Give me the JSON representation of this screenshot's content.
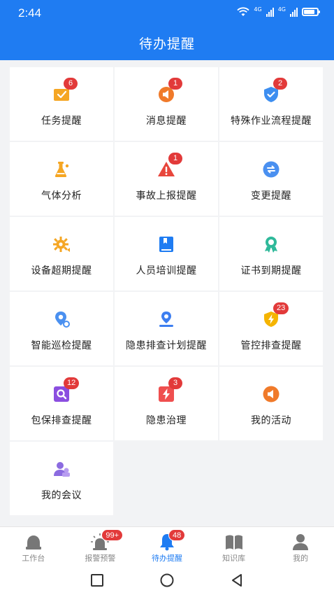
{
  "status_bar": {
    "time": "2:44",
    "network_1": "4G",
    "network_2": "4G"
  },
  "header": {
    "title": "待办提醒"
  },
  "grid": [
    {
      "label": "任务提醒",
      "badge": "6",
      "icon": "task-icon",
      "color": "#f5a623"
    },
    {
      "label": "消息提醒",
      "badge": "1",
      "icon": "message-icon",
      "color": "#f07a2a"
    },
    {
      "label": "特殊作业流程提醒",
      "badge": "2",
      "icon": "shield-check-icon",
      "color": "#3d8ef0"
    },
    {
      "label": "气体分析",
      "badge": "",
      "icon": "flask-icon",
      "color": "#f5a623"
    },
    {
      "label": "事故上报提醒",
      "badge": "1",
      "icon": "warning-icon",
      "color": "#e8463c"
    },
    {
      "label": "变更提醒",
      "badge": "",
      "icon": "exchange-icon",
      "color": "#4a90f0"
    },
    {
      "label": "设备超期提醒",
      "badge": "",
      "icon": "gear-icon",
      "color": "#f5a623"
    },
    {
      "label": "人员培训提醒",
      "badge": "",
      "icon": "book-icon",
      "color": "#1f7cf2"
    },
    {
      "label": "证书到期提醒",
      "badge": "",
      "icon": "certificate-icon",
      "color": "#2fb99a"
    },
    {
      "label": "智能巡检提醒",
      "badge": "",
      "icon": "patrol-icon",
      "color": "#4a90f0"
    },
    {
      "label": "隐患排查计划提醒",
      "badge": "",
      "icon": "location-icon",
      "color": "#3d7ef0"
    },
    {
      "label": "管控排查提醒",
      "badge": "23",
      "icon": "shield-bolt-icon",
      "color": "#f5b400"
    },
    {
      "label": "包保排查提醒",
      "badge": "12",
      "icon": "search-box-icon",
      "color": "#8b4ee0"
    },
    {
      "label": "隐患治理",
      "badge": "3",
      "icon": "bolt-box-icon",
      "color": "#ef4f4f"
    },
    {
      "label": "我的活动",
      "badge": "",
      "icon": "megaphone-icon",
      "color": "#f07a2a"
    },
    {
      "label": "我的会议",
      "badge": "",
      "icon": "meeting-icon",
      "color": "#8b6be0"
    }
  ],
  "tabbar": [
    {
      "label": "工作台",
      "badge": "",
      "icon": "workbench-icon",
      "active": false
    },
    {
      "label": "报警预警",
      "badge": "99+",
      "icon": "alarm-icon",
      "active": false
    },
    {
      "label": "待办提醒",
      "badge": "48",
      "icon": "bell-icon",
      "active": true
    },
    {
      "label": "知识库",
      "badge": "",
      "icon": "knowledge-book-icon",
      "active": false
    },
    {
      "label": "我的",
      "badge": "",
      "icon": "user-icon",
      "active": false
    }
  ],
  "colors": {
    "primary": "#1f7cf2",
    "badge": "#e23a3a",
    "inactive": "#888888"
  }
}
